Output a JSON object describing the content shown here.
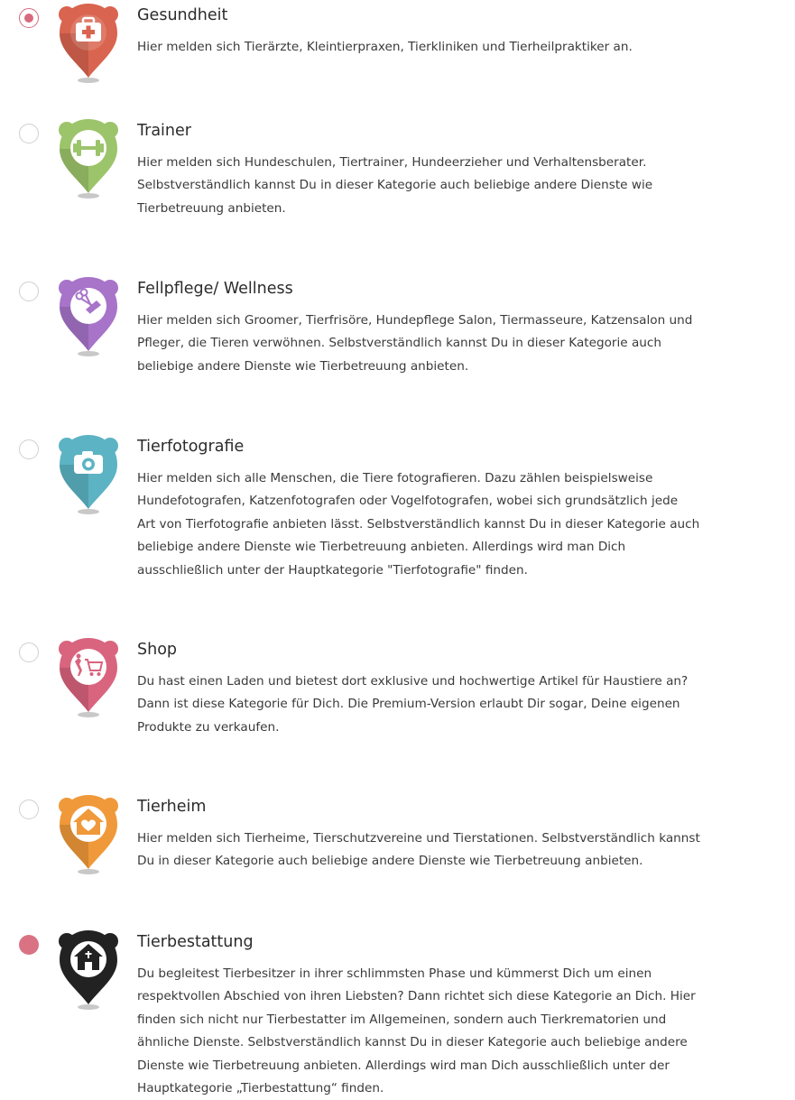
{
  "categories": [
    {
      "title": "Gesundheit",
      "description": "Hier melden sich Tierärzte, Kleintierpraxen, Tierkliniken und Tierheilpraktiker an.",
      "color": "#d9644f",
      "icon": "medical-kit-icon",
      "state": "selected"
    },
    {
      "title": "Trainer",
      "description": "Hier melden sich Hundeschulen, Tiertrainer, Hundeerzieher und Verhaltensberater.\nSelbstverständlich kannst Du in dieser Kategorie auch beliebige andere Dienste wie\nTierbetreuung anbieten.",
      "color": "#9cc46a",
      "icon": "dumbbell-icon",
      "state": "unselected"
    },
    {
      "title": "Fellpflege/ Wellness",
      "description": "Hier melden sich Groomer, Tierfrisöre, Hundepflege Salon, Tiermasseure, Katzensalon und\nPfleger, die Tieren verwöhnen. Selbstverständlich kannst Du in dieser Kategorie auch\nbeliebige andere Dienste wie Tierbetreuung anbieten.",
      "color": "#a774c9",
      "icon": "scissors-comb-icon",
      "state": "unselected"
    },
    {
      "title": "Tierfotografie",
      "description": "Hier melden sich alle Menschen, die Tiere fotografieren. Dazu zählen beispielsweise\nHundefotografen, Katzenfotografen oder Vogelfotografen, wobei sich grundsätzlich jede\nArt von Tierfotografie anbieten lässt. Selbstverständlich kannst Du in dieser Kategorie auch\nbeliebige andere Dienste wie Tierbetreuung anbieten. Allerdings wird man Dich\nausschließlich unter der Hauptkategorie \"Tierfotografie\" finden.",
      "color": "#5cb3c4",
      "icon": "camera-icon",
      "state": "unselected"
    },
    {
      "title": "Shop",
      "description": "Du hast einen Laden und bietest dort exklusive und hochwertige Artikel für Haustiere an?\nDann ist diese Kategorie für Dich. Die Premium-Version erlaubt Dir sogar, Deine eigenen\nProdukte zu verkaufen.",
      "color": "#d9647e",
      "icon": "shopping-cart-icon",
      "state": "unselected"
    },
    {
      "title": "Tierheim",
      "description": "Hier melden sich Tierheime, Tierschutzvereine und Tierstationen. Selbstverständlich kannst\nDu in dieser Kategorie auch beliebige andere Dienste wie Tierbetreuung anbieten.",
      "color": "#f0993a",
      "icon": "house-heart-icon",
      "state": "unselected"
    },
    {
      "title": "Tierbestattung",
      "description": "Du begleitest Tierbesitzer in ihrer schlimmsten Phase und kümmerst Dich um einen\nrespektvollen Abschied von ihren Liebsten? Dann richtet sich diese Kategorie an Dich. Hier\nfinden sich nicht nur Tierbestatter im Allgemeinen, sondern auch Tierkrematorien und\nähnliche Dienste. Selbstverständlich kannst Du in dieser Kategorie auch beliebige andere\nDienste wie Tierbetreuung anbieten. Allerdings wird man Dich ausschließlich unter der\nHauptkategorie „Tierbestattung“ finden.",
      "color": "#222222",
      "icon": "chapel-icon",
      "state": "filled"
    }
  ]
}
